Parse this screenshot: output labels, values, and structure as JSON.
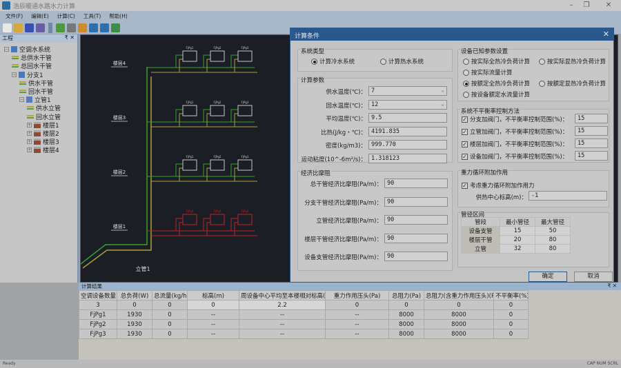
{
  "app": {
    "title": "浩辰暖通水路水力计算"
  },
  "menu": [
    "文件(F)",
    "编辑(E)",
    "计算(C)",
    "工具(T)",
    "帮助(H)"
  ],
  "toolbar_icons": [
    "new-icon",
    "open-icon",
    "save-icon",
    "save-as-icon",
    "refresh-icon",
    "grid-icon",
    "calc-icon",
    "branch-icon",
    "riser-icon",
    "excel-icon"
  ],
  "project_panel": {
    "title": "工程",
    "tree": [
      {
        "label": "空调水系统",
        "level": 0,
        "icon": "system"
      },
      {
        "label": "总供水干管",
        "level": 1,
        "icon": "pipe"
      },
      {
        "label": "总回水干管",
        "level": 1,
        "icon": "pipe"
      },
      {
        "label": "分支1",
        "level": 1,
        "icon": "branch"
      },
      {
        "label": "供水干管",
        "level": 2,
        "icon": "pipe"
      },
      {
        "label": "回水干管",
        "level": 2,
        "icon": "pipe"
      },
      {
        "label": "立管1",
        "level": 2,
        "icon": "riser"
      },
      {
        "label": "供水立管",
        "level": 3,
        "icon": "pipe"
      },
      {
        "label": "回水立管",
        "level": 3,
        "icon": "pipe"
      },
      {
        "label": "楼层1",
        "level": 3,
        "icon": "floor"
      },
      {
        "label": "楼层2",
        "level": 3,
        "icon": "floor"
      },
      {
        "label": "楼层3",
        "level": 3,
        "icon": "floor"
      },
      {
        "label": "楼层4",
        "level": 3,
        "icon": "floor"
      }
    ]
  },
  "drawing": {
    "floors": [
      "楼层4",
      "楼层3",
      "楼层2",
      "楼层1"
    ],
    "riser_label": "立管1",
    "units": [
      "FjPg1",
      "FjPg2",
      "FjPg3"
    ],
    "colors": {
      "supply": "#3aa02e",
      "return": "#a8a040",
      "selected": "#c0222a",
      "unit": "#c8c8c8"
    }
  },
  "dialog": {
    "title": "计算条件",
    "system_type": {
      "title": "系统类型",
      "options": [
        "计算冷水系统",
        "计算热水系统"
      ],
      "selected": 0
    },
    "calc_params": {
      "title": "计算参数",
      "fields": [
        {
          "label": "供水温度(℃)：",
          "value": "7",
          "dropdown": true
        },
        {
          "label": "回水温度(℃)：",
          "value": "12",
          "dropdown": true
        },
        {
          "label": "平均温度(℃)：",
          "value": "9.5"
        },
        {
          "label": "比热(J/kg・℃)：",
          "value": "4191.835"
        },
        {
          "label": "密度(kg/m3)：",
          "value": "999.770"
        },
        {
          "label": "运动粘度(10^-6m²/s)：",
          "value": "1.318123"
        }
      ]
    },
    "econ": {
      "title": "经济比摩阻",
      "fields": [
        {
          "label": "总干管经济比摩阻(Pa/m)：",
          "value": "90"
        },
        {
          "label": "分支干管经济比摩阻(Pa/m)：",
          "value": "90"
        },
        {
          "label": "立管经济比摩阻(Pa/m)：",
          "value": "90"
        },
        {
          "label": "楼层干管经济比摩阻(Pa/m)：",
          "value": "90"
        },
        {
          "label": "设备支管经济比摩阻(Pa/m)：",
          "value": "90"
        }
      ]
    },
    "equip": {
      "title": "设备已知参数设置",
      "options": [
        "按实际全热冷负荷计算",
        "按实际显热冷负荷计算",
        "按实际流量计算",
        "按额定全热冷负荷计算",
        "按额定显热冷负荷计算",
        "按设备额定水流量计算"
      ],
      "selected": 3
    },
    "imbalance": {
      "title": "系统不平衡率控制方法",
      "rows": [
        {
          "label": "分支加阀门，不平衡率控制范围(%)：",
          "checked": true,
          "value": "15"
        },
        {
          "label": "立管加阀门，不平衡率控制范围(%)：",
          "checked": true,
          "value": "15"
        },
        {
          "label": "楼层加阀门，不平衡率控制范围(%)：",
          "checked": true,
          "value": "15"
        },
        {
          "label": "设备加阀门，不平衡率控制范围(%)：",
          "checked": true,
          "value": "15"
        }
      ]
    },
    "gravity": {
      "title": "重力循环附加作用",
      "checkbox": "考虑重力循环附加作用力",
      "checked": true,
      "height_label": "供热中心标高(m)：",
      "height_value": "-1"
    },
    "pipe_range": {
      "title": "管径区间",
      "headers": [
        "管段",
        "最小管径",
        "最大管径"
      ],
      "rows": [
        [
          "设备支管",
          "15",
          "50"
        ],
        [
          "楼层干管",
          "20",
          "80"
        ],
        [
          "立管",
          "32",
          "80"
        ]
      ]
    },
    "ok": "确定",
    "cancel": "取消"
  },
  "results": {
    "title": "计算结果",
    "headers": [
      "空调设备数量",
      "总负荷(W)",
      "总流量(kg/h)",
      "标高(m)",
      "周设备中心平均至本楼相对标高(",
      "重力作用压头(Pa)",
      "总阻力(Pa)",
      "总阻力(含重力作用压头)(Pa)",
      "不平衡率(%)"
    ],
    "rows": [
      [
        "3",
        "0",
        "0",
        "0",
        "2.2",
        "0",
        "0",
        "0",
        "0"
      ],
      [
        "FjPg1",
        "1930",
        "0",
        "--",
        "--",
        "--",
        "8000",
        "8000",
        "0"
      ],
      [
        "FjPg2",
        "1930",
        "0",
        "--",
        "--",
        "--",
        "8000",
        "8000",
        "0"
      ],
      [
        "FjPg3",
        "1930",
        "0",
        "--",
        "--",
        "--",
        "8000",
        "8000",
        "0"
      ]
    ]
  },
  "status": {
    "left": "Ready",
    "right": "CAP  NUM  SCRL"
  }
}
